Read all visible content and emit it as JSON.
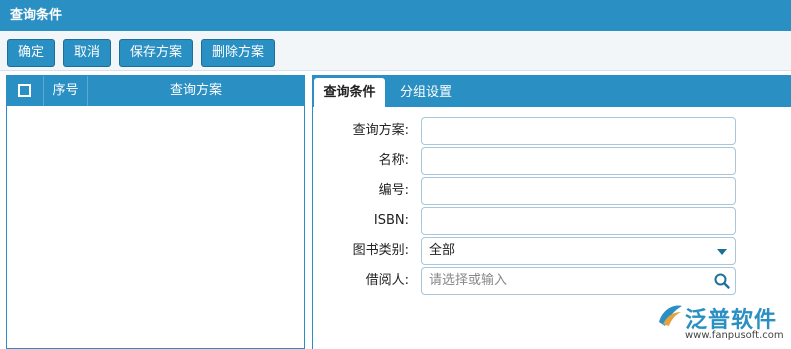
{
  "window": {
    "title": "查询条件"
  },
  "toolbar": {
    "confirm_label": "确定",
    "cancel_label": "取消",
    "save_label": "保存方案",
    "delete_label": "删除方案"
  },
  "scheme_grid": {
    "columns": {
      "number": "序号",
      "scheme": "查询方案"
    },
    "rows": []
  },
  "tabs": [
    {
      "label": "查询条件",
      "active": true
    },
    {
      "label": "分组设置",
      "active": false
    }
  ],
  "form": {
    "scheme": {
      "label": "查询方案:",
      "value": ""
    },
    "name": {
      "label": "名称:",
      "value": ""
    },
    "number": {
      "label": "编号:",
      "value": ""
    },
    "isbn": {
      "label": "ISBN:",
      "value": ""
    },
    "category": {
      "label": "图书类别:",
      "value": "全部"
    },
    "borrower": {
      "label": "借阅人:",
      "value": "",
      "placeholder": "请选择或输入"
    }
  },
  "brand": {
    "name": "泛普软件",
    "url": "www.fanpusoft.com"
  },
  "colors": {
    "accent": "#2a8fc2",
    "accent_dark": "#1d6f99",
    "field_border": "#a9c6da"
  }
}
